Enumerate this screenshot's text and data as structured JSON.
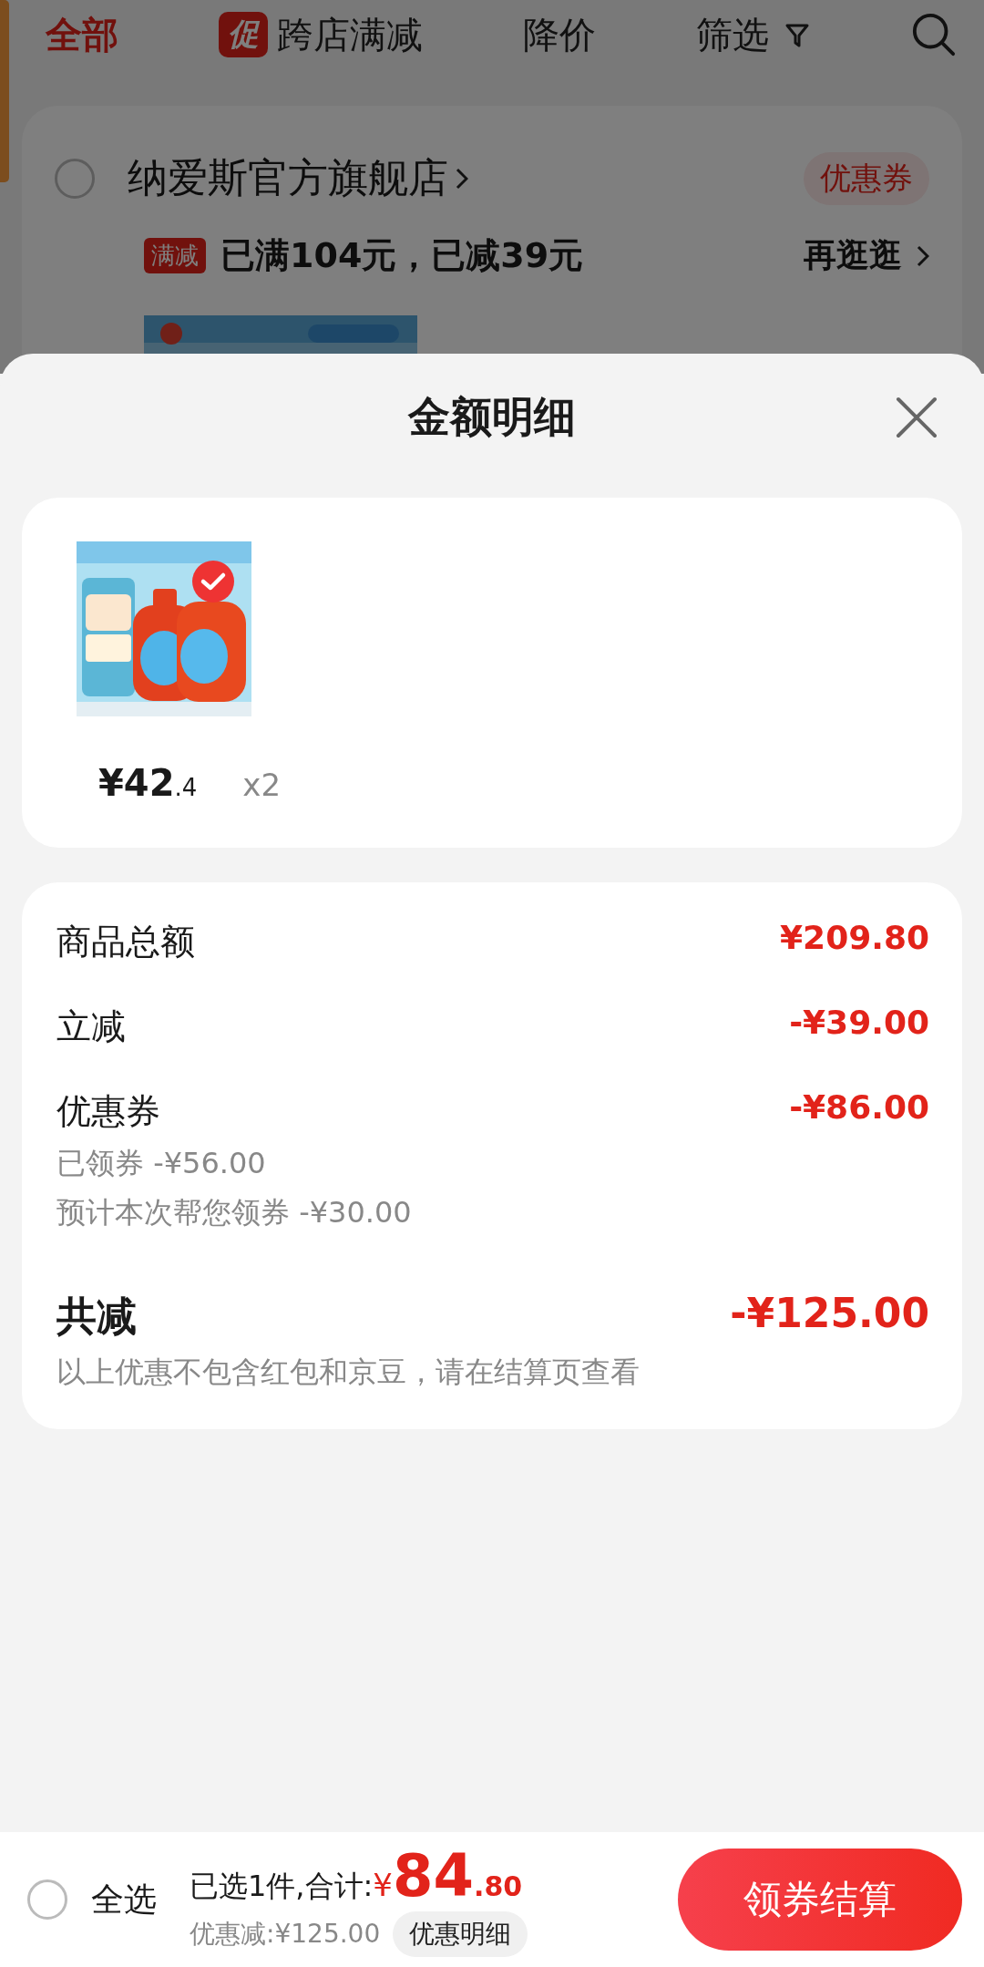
{
  "top_tabs": [
    {
      "label": "全部",
      "selected": true,
      "kind": "plain"
    },
    {
      "label": "跨店满减",
      "badge": "促",
      "selected": false,
      "kind": "promo"
    },
    {
      "label": "降价",
      "selected": false,
      "kind": "plain"
    },
    {
      "label": "筛选",
      "selected": false,
      "kind": "filter"
    }
  ],
  "store": {
    "name": "纳爱斯官方旗舰店",
    "checked": false,
    "coupon_label": "优惠券",
    "promo_tag": "满减",
    "promo_text": "已满104元，已减39元",
    "more_link": "再逛逛"
  },
  "sheet": {
    "title": "金额明细"
  },
  "items": [
    {
      "price_main": "¥42",
      "price_decimal": ".4",
      "quantity": "x2",
      "selected": true
    }
  ],
  "summary": {
    "rows": [
      {
        "label": "商品总额",
        "amount": "¥209.80",
        "details": []
      },
      {
        "label": "立减",
        "amount": "-¥39.00",
        "details": []
      },
      {
        "label": "优惠券",
        "amount": "-¥86.00",
        "details": [
          "已领券 -¥56.00",
          "预计本次帮您领券 -¥30.00"
        ]
      }
    ],
    "total": {
      "label": "共减",
      "amount": "-¥125.00",
      "note": "以上优惠不包含红包和京豆，请在结算页查看"
    }
  },
  "bottom_bar": {
    "select_all": {
      "label": "全选",
      "checked": false
    },
    "selected_text": "已选1件,合计:",
    "currency": "¥",
    "total_main": "84",
    "total_decimal": ".80",
    "discount_text": "优惠减:¥125.00",
    "details_button": "优惠明细",
    "checkout_button": "领券结算"
  }
}
